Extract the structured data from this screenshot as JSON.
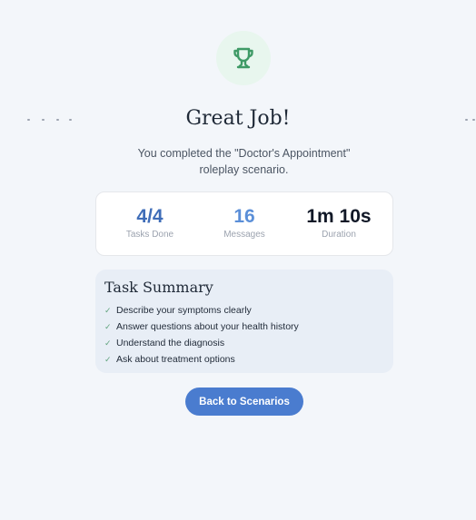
{
  "title": "Great Job!",
  "subtitle": "You completed the \"Doctor's Appointment\" roleplay scenario.",
  "trophy_icon": "trophy-icon",
  "colors": {
    "accent": "#4a7ccf",
    "success": "#5fa37c",
    "tasks_value": "#3f6db8",
    "messages_value": "#5b8fd8"
  },
  "stats": [
    {
      "value": "4/4",
      "label": "Tasks Done"
    },
    {
      "value": "16",
      "label": "Messages"
    },
    {
      "value": "1m 10s",
      "label": "Duration"
    }
  ],
  "task_summary": {
    "heading": "Task Summary",
    "items": [
      "Describe your symptoms clearly",
      "Answer questions about your health history",
      "Understand the diagnosis",
      "Ask about treatment options"
    ]
  },
  "back_button": "Back to Scenarios"
}
